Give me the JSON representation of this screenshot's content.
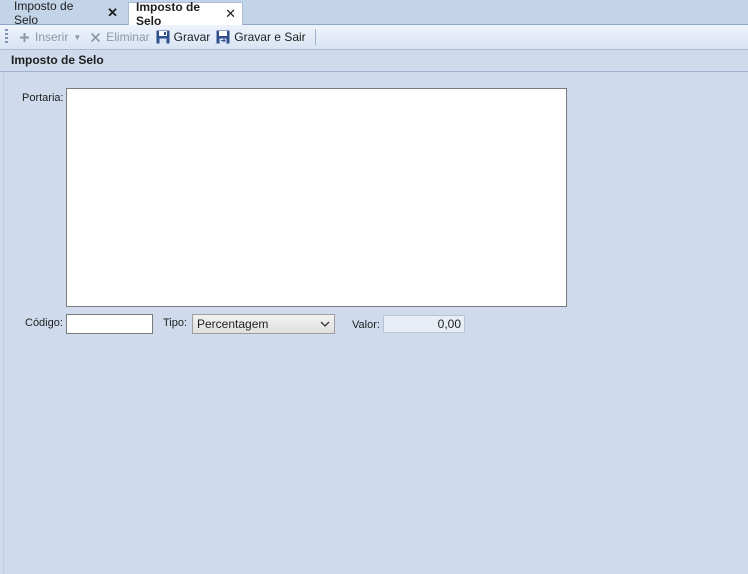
{
  "tabs": [
    {
      "label": "Imposto de Selo",
      "active": false
    },
    {
      "label": "Imposto de Selo",
      "active": true
    }
  ],
  "toolbar": {
    "insert_label": "Inserir",
    "delete_label": "Eliminar",
    "save_label": "Gravar",
    "save_exit_label": "Gravar e Sair"
  },
  "group": {
    "title": "Imposto de Selo"
  },
  "form": {
    "portaria_label": "Portaria:",
    "portaria_value": "",
    "codigo_label": "Código:",
    "codigo_value": "",
    "tipo_label": "Tipo:",
    "tipo_value": "Percentagem",
    "valor_label": "Valor:",
    "valor_value": "0,00"
  },
  "colors": {
    "background": "#cfdbec",
    "disabled_text": "#8b96a6",
    "save_icon": "#2f4f8f"
  }
}
